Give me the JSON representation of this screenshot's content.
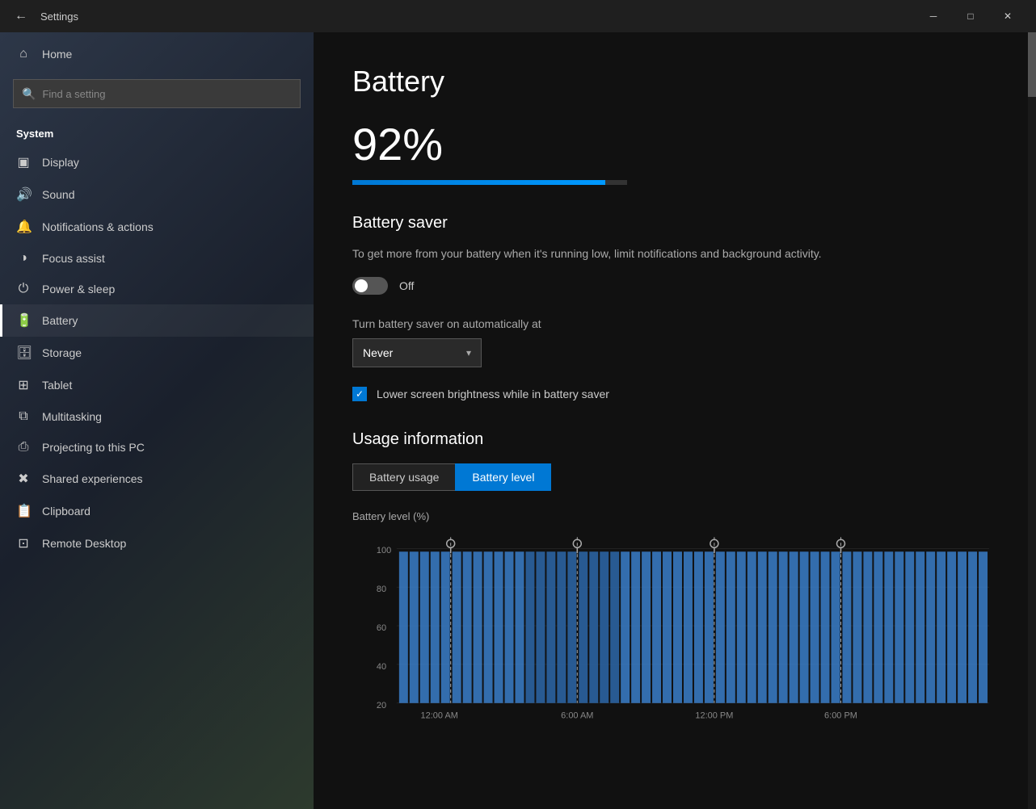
{
  "titlebar": {
    "back_icon": "←",
    "title": "Settings",
    "minimize_label": "─",
    "maximize_label": "□",
    "close_label": "✕"
  },
  "sidebar": {
    "search_placeholder": "Find a setting",
    "search_icon": "🔍",
    "section_title": "System",
    "items": [
      {
        "id": "home",
        "label": "Home",
        "icon": "⌂"
      },
      {
        "id": "display",
        "label": "Display",
        "icon": "□"
      },
      {
        "id": "sound",
        "label": "Sound",
        "icon": "♪"
      },
      {
        "id": "notifications",
        "label": "Notifications & actions",
        "icon": "☰"
      },
      {
        "id": "focus",
        "label": "Focus assist",
        "icon": "◑"
      },
      {
        "id": "power",
        "label": "Power & sleep",
        "icon": "⏻"
      },
      {
        "id": "battery",
        "label": "Battery",
        "icon": "🔋",
        "active": true
      },
      {
        "id": "storage",
        "label": "Storage",
        "icon": "💾"
      },
      {
        "id": "tablet",
        "label": "Tablet",
        "icon": "⊞"
      },
      {
        "id": "multitasking",
        "label": "Multitasking",
        "icon": "⧉"
      },
      {
        "id": "projecting",
        "label": "Projecting to this PC",
        "icon": "⎙"
      },
      {
        "id": "shared",
        "label": "Shared experiences",
        "icon": "✕"
      },
      {
        "id": "clipboard",
        "label": "Clipboard",
        "icon": "📋"
      },
      {
        "id": "remote",
        "label": "Remote Desktop",
        "icon": "⊡"
      }
    ]
  },
  "content": {
    "page_title": "Battery",
    "battery_percent": "92%",
    "battery_fill_percent": 92,
    "battery_saver": {
      "section_title": "Battery saver",
      "description": "To get more from your battery when it's running low, limit notifications and background activity.",
      "toggle_state": "off",
      "toggle_label": "Off",
      "auto_label": "Turn battery saver on automatically at",
      "dropdown_value": "Never",
      "checkbox_label": "Lower screen brightness while in battery saver",
      "checkbox_checked": true
    },
    "usage": {
      "section_title": "Usage information",
      "chart_label": "Battery level (%)",
      "tab_usage": "Battery usage",
      "tab_level": "Battery level",
      "active_tab": "Battery level",
      "y_labels": [
        "100",
        "80",
        "60",
        "40",
        "20"
      ],
      "x_labels": [
        "12:00 AM",
        "6:00 AM",
        "12:00 PM",
        "6:00 PM"
      ]
    }
  },
  "colors": {
    "accent": "#0078d4",
    "sidebar_bg_start": "#2d3748",
    "sidebar_bg_end": "#1a202c",
    "content_bg": "#111111",
    "battery_bar": "#0078d4"
  }
}
